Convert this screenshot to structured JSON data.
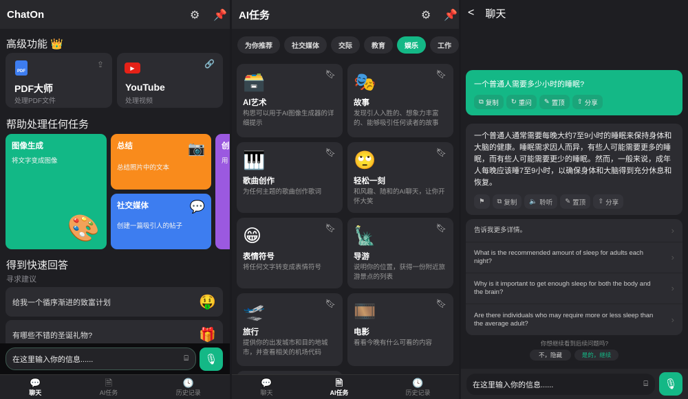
{
  "colors": {
    "accent": "#14b886",
    "orange": "#f98b1c",
    "blue": "#3d7df0",
    "purple": "#9b59e0",
    "bg": "#1e1e22"
  },
  "home": {
    "title": "ChatOn",
    "premium_heading": "高级功能",
    "premium": [
      {
        "icon": "pdf-icon",
        "badge": "PDF",
        "title": "PDF大师",
        "sub": "处理PDF文件",
        "action_icon": "upload-icon"
      },
      {
        "icon": "youtube-icon",
        "title": "YouTube",
        "sub": "处理视频",
        "action_icon": "link-icon"
      }
    ],
    "tasks_heading": "帮助处理任何任务",
    "tasks": [
      {
        "title": "图像生成",
        "sub": "将文字变成图像",
        "emoji": "🎨"
      },
      {
        "title": "总结",
        "sub": "总结照片中的文本",
        "emoji": "📷"
      },
      {
        "title": "社交媒体",
        "sub": "创建一篇吸引人的帖子",
        "emoji": "💬"
      },
      {
        "title": "创",
        "sub": "用"
      }
    ],
    "quick_heading": "得到快速回答",
    "quick_sub": "寻求建议",
    "suggestions": [
      {
        "text": "给我一个循序渐进的致富计划",
        "emoji": "🤑"
      },
      {
        "text": "有哪些不错的圣诞礼物?",
        "emoji": "🎁"
      }
    ],
    "input_placeholder": "在这里输入你的信息......"
  },
  "nav": [
    {
      "label": "聊天",
      "icon": "chat-bubble-icon"
    },
    {
      "label": "AI任务",
      "icon": "document-icon"
    },
    {
      "label": "历史记录",
      "icon": "clock-icon"
    }
  ],
  "tasks_page": {
    "title": "AI任务",
    "chips": [
      "为你推荐",
      "社交媒体",
      "交际",
      "教育",
      "娱乐",
      "工作"
    ],
    "active_chip": "娱乐",
    "cards": [
      {
        "emoji": "🗃️",
        "title": "AI艺术",
        "desc": "构思可以用于AI图像生成器的详细提示"
      },
      {
        "emoji": "🎭",
        "title": "故事",
        "desc": "发现引人入胜的、想象力丰富的、能够吸引任何读者的故事"
      },
      {
        "emoji": "🎹",
        "title": "歌曲创作",
        "desc": "为任何主题的歌曲创作歌词"
      },
      {
        "emoji": "🙄",
        "title": "轻松一刻",
        "desc": "和风趣、随和的AI聊天，让你开怀大笑"
      },
      {
        "emoji": "😁",
        "title": "表情符号",
        "desc": "将任何文字转变成表情符号"
      },
      {
        "emoji": "🗽",
        "title": "导游",
        "desc": "说明你的位置，获得一份附近旅游景点的列表"
      },
      {
        "emoji": "🛫",
        "title": "旅行",
        "desc": "提供你的出发城市和目的地城市，并查看相关的机场代码"
      },
      {
        "emoji": "🎞️",
        "title": "电影",
        "desc": "看看今晚有什么可看的内容"
      }
    ]
  },
  "chat": {
    "title": "聊天",
    "question": "一个普通人需要多少小时的睡眠?",
    "question_actions": [
      "复制",
      "重问",
      "置顶",
      "分享"
    ],
    "answer": "一个普通人通常需要每晚大约7至9小时的睡眠来保持身体和大脑的健康。睡眠需求因人而异，有些人可能需要更多的睡眠，而有些人可能需要更少的睡眠。然而，一般来说，成年人每晚应该睡7至9小时，以确保身体和大脑得到充分休息和恢复。",
    "answer_actions": [
      "复制",
      "聆听",
      "置顶",
      "分享"
    ],
    "followups": [
      "告诉我更多详情。",
      "What is the recommended amount of sleep for adults each night?",
      "Why is it important to get enough sleep for both the body and the brain?",
      "Are there individuals who may require more or less sleep than the average adult?"
    ],
    "followup_prompt": "你想继续看到后续问题吗?",
    "no_label": "不，隐藏",
    "yes_label": "是的，继续",
    "input_placeholder": "在这里输入你的信息......"
  }
}
